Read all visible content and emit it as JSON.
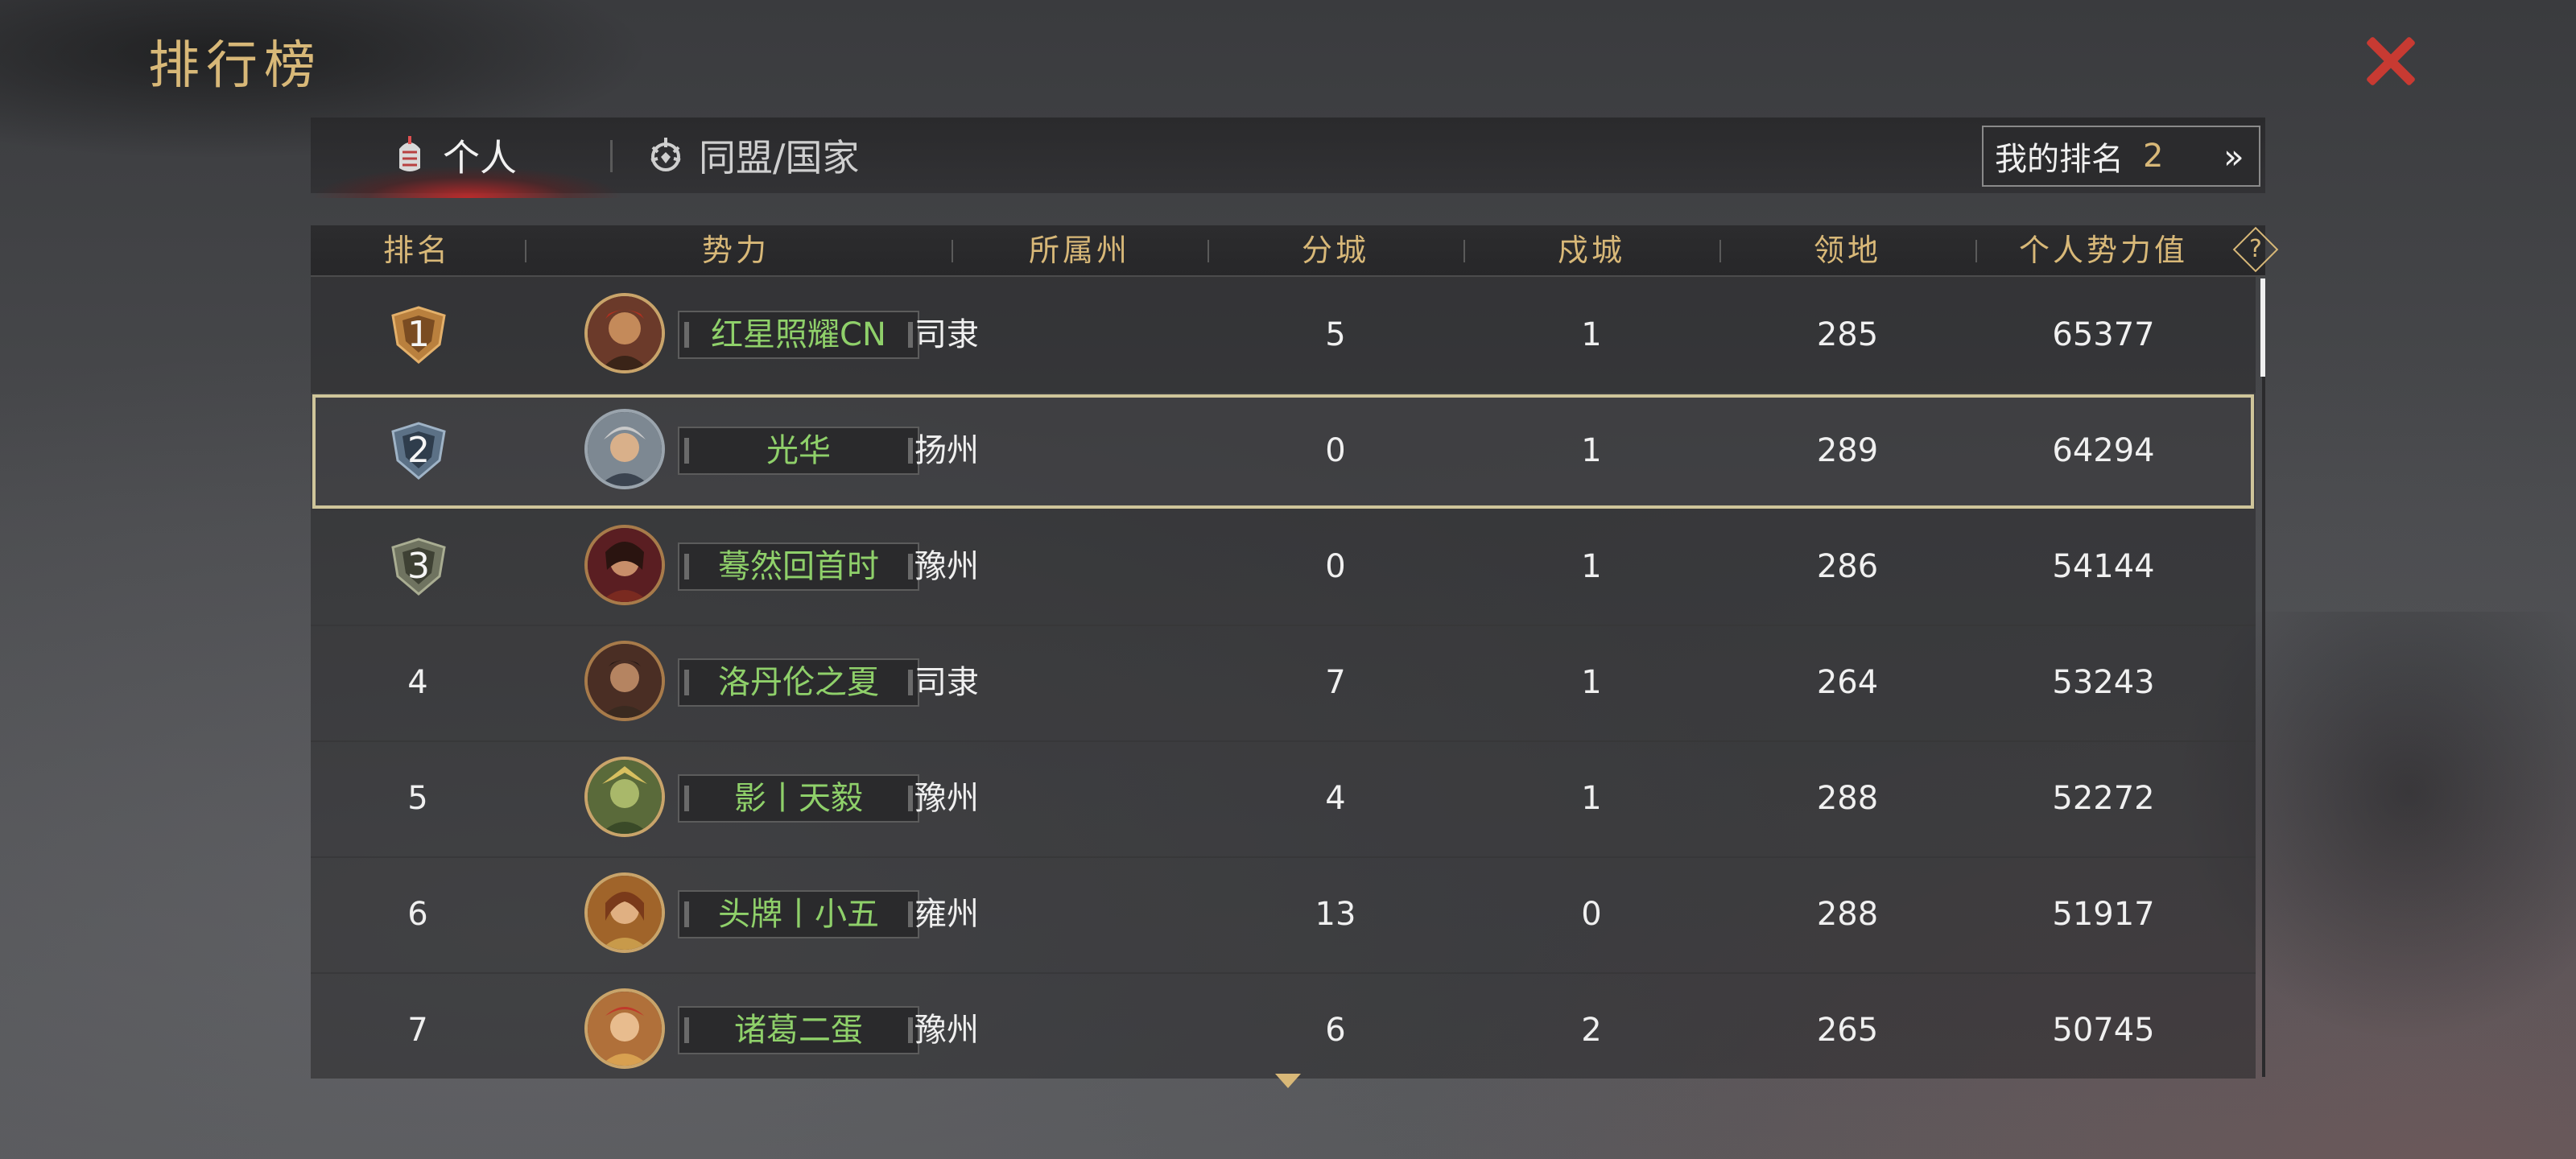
{
  "title": "排行榜",
  "tabs": [
    {
      "label": "个人",
      "icon": "fist-icon"
    },
    {
      "label": "同盟/国家",
      "icon": "alliance-emblem-icon"
    }
  ],
  "my_rank": {
    "label": "我的排名",
    "value": "2",
    "arrow": "»"
  },
  "columns": [
    "排名",
    "势力",
    "所属州",
    "分城",
    "戍城",
    "领地",
    "个人势力值"
  ],
  "help": "?",
  "rows": [
    {
      "rank": "1",
      "name": "红星照耀CN",
      "province": "司隶",
      "branch": "5",
      "garrison": "1",
      "territory": "285",
      "power": "65377",
      "badge": "gold-rank-badge-icon"
    },
    {
      "rank": "2",
      "name": "光华",
      "province": "扬州",
      "branch": "0",
      "garrison": "1",
      "territory": "289",
      "power": "64294",
      "badge": "silver-rank-badge-icon"
    },
    {
      "rank": "3",
      "name": "蓦然回首时",
      "province": "豫州",
      "branch": "0",
      "garrison": "1",
      "territory": "286",
      "power": "54144",
      "badge": "bronze-rank-badge-icon"
    },
    {
      "rank": "4",
      "name": "洛丹伦之夏",
      "province": "司隶",
      "branch": "7",
      "garrison": "1",
      "territory": "264",
      "power": "53243"
    },
    {
      "rank": "5",
      "name": "影丨天毅",
      "province": "豫州",
      "branch": "4",
      "garrison": "1",
      "territory": "288",
      "power": "52272"
    },
    {
      "rank": "6",
      "name": "头牌丨小五",
      "province": "雍州",
      "branch": "13",
      "garrison": "0",
      "territory": "288",
      "power": "51917"
    },
    {
      "rank": "7",
      "name": "诸葛二蛋",
      "province": "豫州",
      "branch": "6",
      "garrison": "2",
      "territory": "265",
      "power": "50745"
    }
  ],
  "colors": {
    "gold": "#d8b878",
    "name_green": "#8fd06a",
    "close_red": "#c83a32",
    "active_tab_glow": "#c82828"
  }
}
